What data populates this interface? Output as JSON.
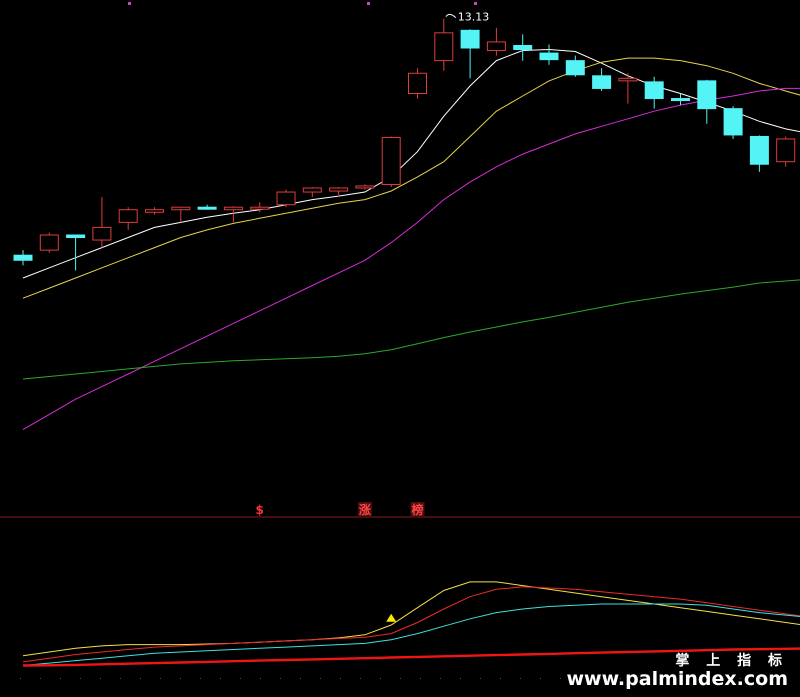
{
  "chart_data": [
    {
      "type": "candlestick",
      "panel": "main",
      "annotation": {
        "label": "13.13",
        "candle_index": 16
      },
      "ylim": [
        4.2,
        13.5
      ],
      "candles": [
        {
          "open": 8.45,
          "high": 8.55,
          "low": 8.25,
          "close": 8.35
        },
        {
          "open": 8.55,
          "high": 8.9,
          "low": 8.5,
          "close": 8.85
        },
        {
          "open": 8.85,
          "high": 8.85,
          "low": 8.15,
          "close": 8.8
        },
        {
          "open": 8.75,
          "high": 9.6,
          "low": 8.6,
          "close": 9.0
        },
        {
          "open": 9.1,
          "high": 9.4,
          "low": 8.95,
          "close": 9.35
        },
        {
          "open": 9.3,
          "high": 9.4,
          "low": 9.25,
          "close": 9.35
        },
        {
          "open": 9.35,
          "high": 9.4,
          "low": 9.1,
          "close": 9.4
        },
        {
          "open": 9.4,
          "high": 9.45,
          "low": 9.35,
          "close": 9.37
        },
        {
          "open": 9.35,
          "high": 9.42,
          "low": 9.1,
          "close": 9.4
        },
        {
          "open": 9.4,
          "high": 9.5,
          "low": 9.3,
          "close": 9.4
        },
        {
          "open": 9.45,
          "high": 9.75,
          "low": 9.4,
          "close": 9.7
        },
        {
          "open": 9.7,
          "high": 9.8,
          "low": 9.6,
          "close": 9.78
        },
        {
          "open": 9.72,
          "high": 9.8,
          "low": 9.6,
          "close": 9.78
        },
        {
          "open": 9.8,
          "high": 9.85,
          "low": 9.75,
          "close": 9.82
        },
        {
          "open": 9.85,
          "high": 10.8,
          "low": 9.8,
          "close": 10.78
        },
        {
          "open": 11.65,
          "high": 12.15,
          "low": 11.55,
          "close": 12.05
        },
        {
          "open": 12.3,
          "high": 13.13,
          "low": 12.1,
          "close": 12.85
        },
        {
          "open": 12.9,
          "high": 12.92,
          "low": 11.95,
          "close": 12.55
        },
        {
          "open": 12.5,
          "high": 12.95,
          "low": 12.4,
          "close": 12.67
        },
        {
          "open": 12.6,
          "high": 12.82,
          "low": 12.3,
          "close": 12.52
        },
        {
          "open": 12.45,
          "high": 12.62,
          "low": 12.22,
          "close": 12.32
        },
        {
          "open": 12.3,
          "high": 12.4,
          "low": 11.98,
          "close": 12.02
        },
        {
          "open": 12.0,
          "high": 12.15,
          "low": 11.7,
          "close": 11.75
        },
        {
          "open": 11.9,
          "high": 12.05,
          "low": 11.45,
          "close": 11.95
        },
        {
          "open": 11.88,
          "high": 11.98,
          "low": 11.35,
          "close": 11.55
        },
        {
          "open": 11.55,
          "high": 11.65,
          "low": 11.42,
          "close": 11.52
        },
        {
          "open": 11.9,
          "high": 11.92,
          "low": 11.05,
          "close": 11.35
        },
        {
          "open": 11.35,
          "high": 11.4,
          "low": 10.75,
          "close": 10.83
        },
        {
          "open": 10.8,
          "high": 10.82,
          "low": 10.1,
          "close": 10.25
        },
        {
          "open": 10.3,
          "high": 10.8,
          "low": 10.2,
          "close": 10.75
        },
        {
          "open": 10.8,
          "high": 10.88,
          "low": 10.7,
          "close": 10.78
        }
      ],
      "moving_averages": [
        {
          "color": "#ffffff",
          "values": [
            8.0,
            8.2,
            8.4,
            8.6,
            8.8,
            9.0,
            9.1,
            9.2,
            9.28,
            9.35,
            9.45,
            9.55,
            9.62,
            9.7,
            10.0,
            10.5,
            11.2,
            11.8,
            12.3,
            12.5,
            12.52,
            12.48,
            12.25,
            12.0,
            11.8,
            11.65,
            11.48,
            11.3,
            11.1,
            10.95,
            10.85
          ]
        },
        {
          "color": "#e8d24a",
          "values": [
            7.6,
            7.8,
            8.0,
            8.2,
            8.4,
            8.6,
            8.8,
            8.95,
            9.08,
            9.18,
            9.28,
            9.38,
            9.48,
            9.55,
            9.72,
            10.0,
            10.3,
            10.8,
            11.3,
            11.6,
            11.9,
            12.1,
            12.27,
            12.35,
            12.35,
            12.3,
            12.2,
            12.05,
            11.85,
            11.7,
            11.55
          ]
        },
        {
          "color": "#d52ed8",
          "values": [
            5.0,
            5.3,
            5.6,
            5.85,
            6.1,
            6.35,
            6.6,
            6.85,
            7.1,
            7.35,
            7.6,
            7.85,
            8.1,
            8.35,
            8.7,
            9.1,
            9.55,
            9.9,
            10.2,
            10.45,
            10.65,
            10.85,
            11.0,
            11.15,
            11.3,
            11.42,
            11.52,
            11.6,
            11.7,
            11.75,
            11.75
          ]
        },
        {
          "color": "#2ca82c",
          "values": [
            6.0,
            6.05,
            6.1,
            6.15,
            6.2,
            6.25,
            6.3,
            6.33,
            6.36,
            6.38,
            6.4,
            6.42,
            6.45,
            6.5,
            6.58,
            6.7,
            6.82,
            6.93,
            7.03,
            7.13,
            7.22,
            7.32,
            7.42,
            7.52,
            7.6,
            7.68,
            7.75,
            7.82,
            7.9,
            7.94,
            7.98
          ]
        }
      ],
      "markers": [
        {
          "text": "$",
          "candle_index": 9,
          "color": "#ff3333"
        },
        {
          "text": "涨",
          "candle_index": 13,
          "color": "#ff4444"
        },
        {
          "text": "榜",
          "candle_index": 15,
          "color": "#ff4444"
        }
      ],
      "colors": {
        "up": "#e03c3c",
        "down": "#54f3f5"
      }
    },
    {
      "type": "line",
      "panel": "indicator",
      "ylim": [
        0,
        100
      ],
      "series": [
        {
          "color": "#f2e14a",
          "values": [
            10,
            13,
            16,
            18,
            19,
            19,
            19,
            19.5,
            20,
            21,
            22,
            23,
            24.5,
            27,
            35,
            49,
            63,
            70,
            70,
            67,
            64,
            61,
            58,
            55,
            52,
            49,
            46,
            43,
            40,
            37,
            34
          ]
        },
        {
          "color": "#ee2a2a",
          "values": [
            5,
            8,
            11,
            13,
            15,
            17,
            18,
            19,
            20,
            21,
            22,
            23,
            24,
            25,
            28,
            37,
            48,
            58,
            64,
            66,
            65,
            64,
            62,
            60,
            58,
            56,
            53,
            50,
            47,
            44,
            41
          ]
        },
        {
          "color": "#3fe0e0",
          "values": [
            2,
            4,
            6,
            8,
            10,
            12,
            13,
            14,
            15,
            16,
            17,
            18,
            19,
            20,
            23,
            28,
            34,
            40,
            45,
            48,
            50,
            51,
            52,
            52,
            52,
            52,
            51,
            48,
            45,
            43,
            41
          ]
        },
        {
          "color": "#f01515",
          "width": 2.4,
          "values": [
            2,
            2.2,
            2.5,
            3,
            3.5,
            4,
            4.5,
            5,
            5.5,
            6,
            6.5,
            7,
            7.5,
            8,
            8.5,
            9,
            9.5,
            10,
            10.5,
            11,
            11.5,
            12,
            12.5,
            13,
            13.5,
            14,
            14.5,
            15,
            15.3,
            15.6,
            16
          ]
        }
      ],
      "marker": {
        "shape": "triangle-up",
        "color": "#ffe800",
        "candle_index": 14,
        "value": 40
      }
    }
  ],
  "watermark": {
    "line1": "掌 上 指 标",
    "line2": "www.palmindex.com"
  },
  "colors": {
    "background": "#000000",
    "separator": "#8a1a1a",
    "dots": "#cc44cc",
    "grid_dots": "#1f6b3a"
  }
}
